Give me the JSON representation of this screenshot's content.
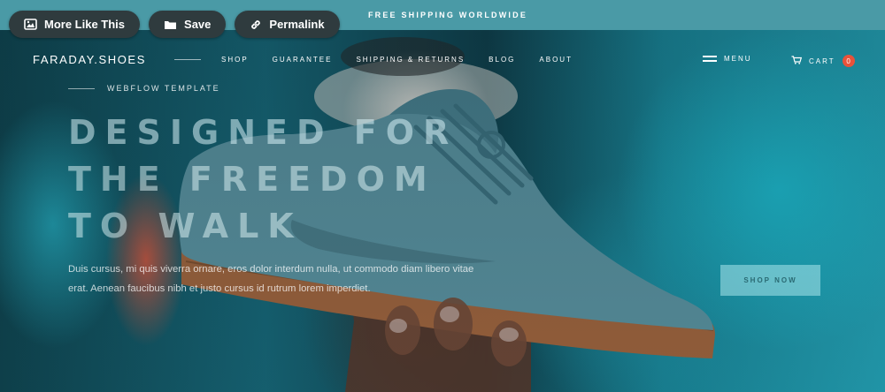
{
  "announcement": {
    "text": "FREE SHIPPING WORLDWIDE"
  },
  "overlay_actions": [
    {
      "label": "More Like This",
      "icon": "image-icon"
    },
    {
      "label": "Save",
      "icon": "folder-icon"
    },
    {
      "label": "Permalink",
      "icon": "link-icon"
    }
  ],
  "nav": {
    "brand": "FARADAY.SHOES",
    "links": [
      "SHOP",
      "GUARANTEE",
      "SHIPPING & RETURNS",
      "BLOG",
      "ABOUT"
    ],
    "menu_label": "MENU",
    "cart_label": "CART",
    "cart_count": "0"
  },
  "hero": {
    "eyebrow": "WEBFLOW TEMPLATE",
    "headline_lines": [
      "DESIGNED FOR",
      "THE FREEDOM",
      "TO WALK"
    ],
    "paragraph": "Duis cursus, mi quis viverra ornare, eros dolor interdum nulla, ut commodo diam libero vitae erat. Aenean faucibus nibh et justo cursus id rutrum lorem imperdiet.",
    "cta_label": "SHOP NOW"
  },
  "colors": {
    "topbar": "#4a9aa6",
    "pill": "#2f3b3e",
    "cart_badge": "#e8523a",
    "shoe_suede": "#5f98a6",
    "shoe_sole": "#a8673d"
  }
}
